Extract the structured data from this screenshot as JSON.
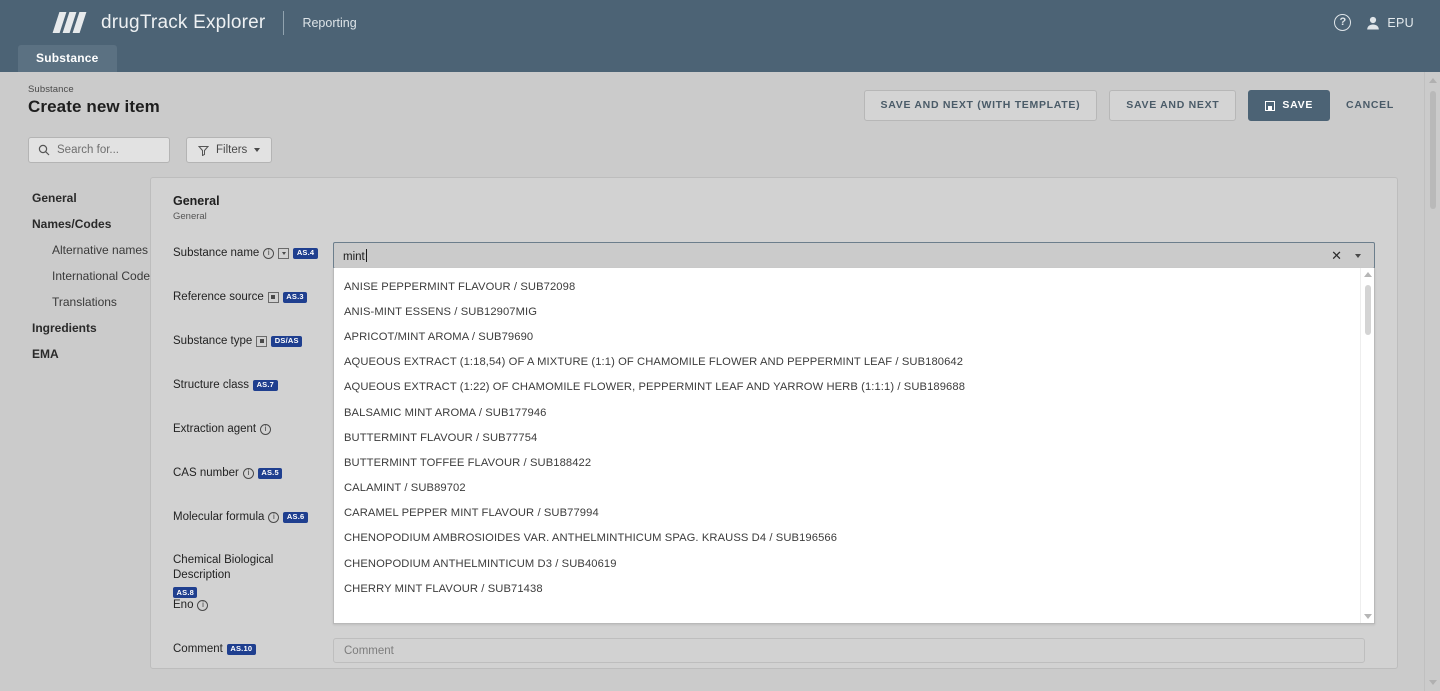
{
  "header": {
    "brand_prefix": "drug",
    "brand_suffix": "Track Explorer",
    "brand": "drugTrack Explorer",
    "section": "Reporting",
    "help_icon": "question-mark-icon",
    "user_icon": "person-icon",
    "user": "EPU"
  },
  "tabs": [
    {
      "label": "Substance",
      "active": true
    }
  ],
  "page": {
    "breadcrumb": "Substance",
    "title": "Create new item"
  },
  "toolbar": {
    "save_and_next_with_template": "SAVE AND NEXT (WITH TEMPLATE)",
    "save_and_next": "SAVE AND NEXT",
    "save": "SAVE",
    "save_icon": "floppy-disk-icon",
    "cancel": "CANCEL"
  },
  "search": {
    "icon": "search-icon",
    "placeholder": "Search for...",
    "value": "",
    "filters_label": "Filters",
    "filters_icon": "funnel-icon",
    "filters_caret": "chevron-down-icon"
  },
  "sidebar": {
    "items": [
      {
        "label": "General",
        "type": "group"
      },
      {
        "label": "Names/Codes",
        "type": "group"
      },
      {
        "label": "Alternative names",
        "type": "sub"
      },
      {
        "label": "International Codes",
        "type": "sub"
      },
      {
        "label": "Translations",
        "type": "sub"
      },
      {
        "label": "Ingredients",
        "type": "group"
      },
      {
        "label": "EMA",
        "type": "group"
      }
    ]
  },
  "section": {
    "title": "General",
    "subtitle": "General"
  },
  "fields": [
    {
      "label": "Substance name",
      "info_icon": "info-circle-icon",
      "box_icon": "dropdown-box-icon",
      "badge": "AS.4",
      "value": "mint",
      "clear_icon": "close-icon",
      "arrow_icon": "chevron-down-icon"
    },
    {
      "label": "Reference source",
      "box_icon": "select-box-icon",
      "badge": "AS.3"
    },
    {
      "label": "Substance type",
      "box_icon": "select-box-icon",
      "badge": "DS/AS"
    },
    {
      "label": "Structure class",
      "badge": "AS.7"
    },
    {
      "label": "Extraction agent",
      "info_icon": "info-circle-icon"
    },
    {
      "label": "CAS number",
      "info_icon": "info-circle-icon",
      "badge": "AS.5"
    },
    {
      "label": "Molecular formula",
      "info_icon": "info-circle-icon",
      "badge": "AS.6"
    },
    {
      "label": "Chemical Biological Description",
      "badge": "AS.8"
    },
    {
      "label": "Eno",
      "info_icon": "info-circle-icon"
    },
    {
      "label": "Comment",
      "badge": "AS.10",
      "placeholder": "Comment",
      "value": ""
    }
  ],
  "dropdown": {
    "options": [
      "ANISE PEPPERMINT FLAVOUR / SUB72098",
      "ANIS-MINT ESSENS / SUB12907MIG",
      "APRICOT/MINT AROMA / SUB79690",
      "AQUEOUS EXTRACT (1:18,54) OF A MIXTURE (1:1) OF CHAMOMILE FLOWER AND PEPPERMINT LEAF / SUB180642",
      "AQUEOUS EXTRACT (1:22) OF CHAMOMILE FLOWER, PEPPERMINT LEAF AND YARROW HERB (1:1:1) / SUB189688",
      "BALSAMIC MINT AROMA / SUB177946",
      "BUTTERMINT FLAVOUR / SUB77754",
      "BUTTERMINT TOFFEE FLAVOUR / SUB188422",
      "CALAMINT / SUB89702",
      "CARAMEL PEPPER MINT FLAVOUR / SUB77994",
      "CHENOPODIUM AMBROSIOIDES VAR. ANTHELMINTHICUM SPAG. KRAUSS D4 / SUB196566",
      "CHENOPODIUM ANTHELMINTICUM D3 / SUB40619",
      "CHERRY MINT FLAVOUR / SUB71438"
    ]
  },
  "colors": {
    "header_bg": "#4c6375",
    "page_bg": "#cbcbcb",
    "badge_blue": "#1f3f8f",
    "panel_bg": "#d2d2d2"
  }
}
